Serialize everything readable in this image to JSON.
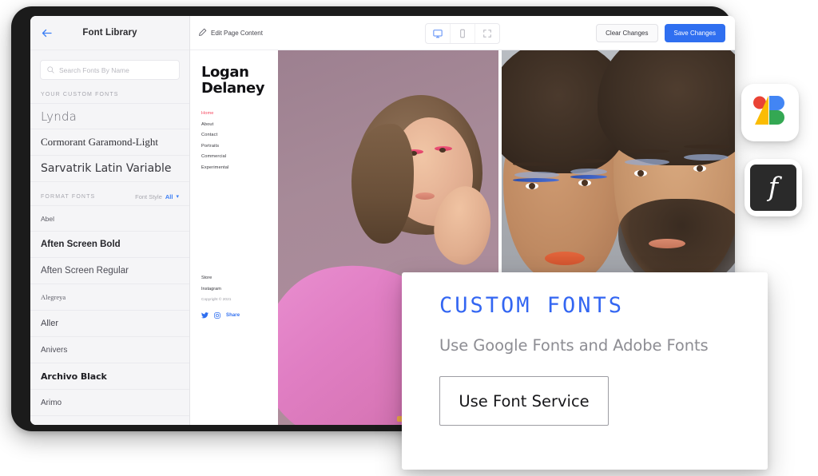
{
  "sidebar": {
    "title": "Font Library",
    "back_icon": "back-arrow-icon",
    "search": {
      "placeholder": "Search Fonts By Name",
      "value": "",
      "icon": "search-icon"
    },
    "custom_section_label": "YOUR CUSTOM FONTS",
    "custom_fonts": [
      {
        "name": "Lynda",
        "style_class": "f-lynda"
      },
      {
        "name": "Cormorant Garamond-Light",
        "style_class": "f-cormorant"
      },
      {
        "name": "Sarvatrik Latin Variable",
        "style_class": "f-sarvatrik"
      }
    ],
    "format_section_label": "FORMAT FONTS",
    "font_style_filter": {
      "label": "Font Style",
      "value": "All",
      "caret_icon": "chevron-down-icon"
    },
    "format_fonts": [
      {
        "name": "Abel",
        "style_class": "f-abel"
      },
      {
        "name": "Aften Screen Bold",
        "style_class": "f-aften-bold"
      },
      {
        "name": "Aften Screen Regular",
        "style_class": "f-aften-reg"
      },
      {
        "name": "Alegreya",
        "style_class": "f-alegreya"
      },
      {
        "name": "Aller",
        "style_class": "f-aller"
      },
      {
        "name": "Anivers",
        "style_class": "f-anivers"
      },
      {
        "name": "Archivo Black",
        "style_class": "f-archivo"
      },
      {
        "name": "Arimo",
        "style_class": "f-arimo"
      }
    ]
  },
  "toolbar": {
    "edit_label": "Edit Page Content",
    "edit_icon": "pencil-icon",
    "viewports": [
      {
        "name": "desktop-view",
        "icon": "desktop-icon",
        "active": true
      },
      {
        "name": "mobile-view",
        "icon": "mobile-icon",
        "active": false
      },
      {
        "name": "fullscreen-view",
        "icon": "fullscreen-icon",
        "active": false
      }
    ],
    "clear_label": "Clear Changes",
    "save_label": "Save Changes",
    "save_color": "#2f6ff0"
  },
  "page_preview": {
    "site_title_line1": "Logan",
    "site_title_line2": "Delaney",
    "nav": [
      {
        "label": "Home",
        "current": true
      },
      {
        "label": "About",
        "current": false
      },
      {
        "label": "Contact",
        "current": false
      },
      {
        "label": "Portraits",
        "current": false
      },
      {
        "label": "Commercial",
        "current": false
      },
      {
        "label": "Experimental",
        "current": false
      }
    ],
    "current_nav_color": "#f5445c",
    "footer_links": [
      "Store",
      "Instagram"
    ],
    "copyright": "Copyright © 2021",
    "share_label": "Share",
    "social_icons": [
      "twitter-icon",
      "instagram-icon"
    ],
    "photos": [
      {
        "name": "portrait-pink-blazer",
        "alt": "Woman in pink blazer on mauve backdrop"
      },
      {
        "name": "portrait-couple-blue-eyeliner",
        "alt": "Two people with blue eyeliner"
      }
    ]
  },
  "custom_fonts_card": {
    "heading": "CUSTOM FONTS",
    "heading_color": "#3366f2",
    "subheading": "Use Google Fonts and Adobe Fonts",
    "button_label": "Use Font Service"
  },
  "service_icons": [
    {
      "name": "google-fonts-icon",
      "label": "Google Fonts"
    },
    {
      "name": "adobe-fonts-icon",
      "label": "Adobe Fonts",
      "glyph": "f"
    }
  ]
}
